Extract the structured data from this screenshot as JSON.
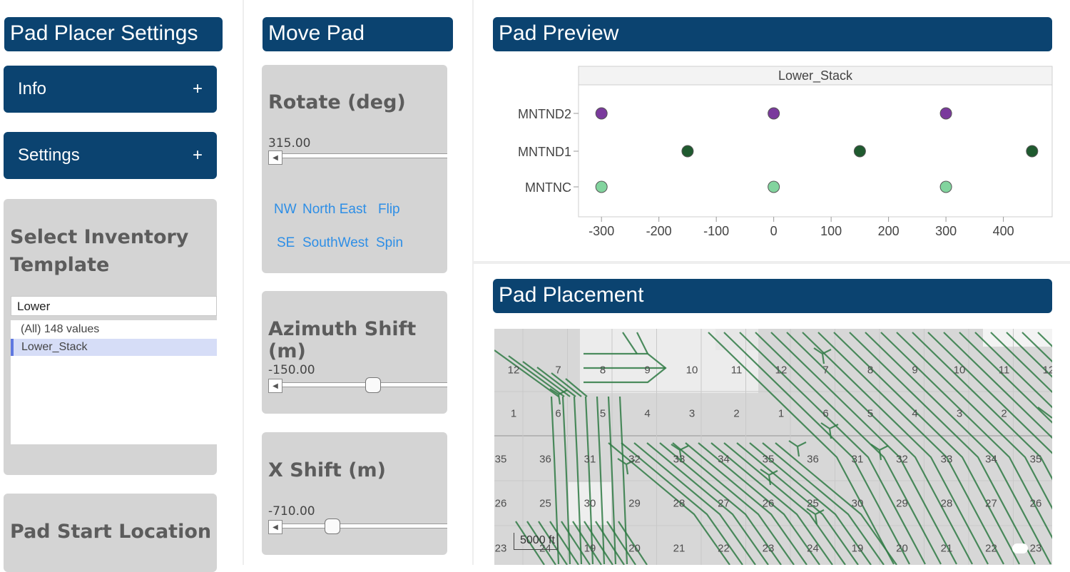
{
  "left": {
    "title": "Pad Placer Settings",
    "info_label": "Info",
    "settings_label": "Settings",
    "expand_glyph": "+",
    "inventory": {
      "title_line1": "Select Inventory",
      "title_line2": "Template",
      "search_value": "Lower",
      "options": [
        "(All) 148 values",
        "Lower_Stack"
      ],
      "selected": "Lower_Stack"
    },
    "pad_start_title": "Pad Start Location"
  },
  "move": {
    "title": "Move Pad",
    "rotate": {
      "title": "Rotate (deg)",
      "value": "315.00",
      "fraction": 0.0
    },
    "directions": [
      "NW",
      "North East",
      "Flip",
      "SE",
      "SouthWest",
      "Spin"
    ],
    "azimuth": {
      "title": "Azimuth Shift (m)",
      "value": "-150.00",
      "fraction": 0.5
    },
    "xshift": {
      "title": "X Shift (m)",
      "value": "-710.00",
      "fraction": 0.25
    }
  },
  "preview": {
    "title": "Pad Preview",
    "chart_data": {
      "type": "scatter",
      "title": "Lower_Stack",
      "categories": [
        "MNTND2",
        "MNTND1",
        "MNTNC"
      ],
      "xticks": [
        -300,
        -200,
        -100,
        0,
        100,
        200,
        300,
        400
      ],
      "xlim": [
        -340,
        485
      ],
      "grid": false,
      "series": [
        {
          "category": "MNTND2",
          "color": "#7a3a9c",
          "x": [
            -300,
            0,
            300
          ]
        },
        {
          "category": "MNTND1",
          "color": "#1f5a2f",
          "x": [
            -150,
            150,
            450
          ]
        },
        {
          "category": "MNTNC",
          "color": "#82d49e",
          "x": [
            -300,
            0,
            300
          ]
        }
      ]
    }
  },
  "placement": {
    "title": "Pad Placement",
    "scale_label": "5000 ft",
    "section_rows": [
      [
        "12",
        "7",
        "8",
        "9",
        "10",
        "11",
        "12",
        "7",
        "8",
        "9",
        "10",
        "11",
        "12"
      ],
      [
        "1",
        "6",
        "5",
        "4",
        "3",
        "2",
        "1",
        "6",
        "5",
        "4",
        "3",
        "2"
      ],
      [
        "35",
        "36",
        "31",
        "32",
        "33",
        "34",
        "35",
        "36",
        "31",
        "32",
        "33",
        "34",
        "35"
      ],
      [
        "26",
        "25",
        "30",
        "29",
        "28",
        "27",
        "26",
        "25",
        "30",
        "29",
        "28",
        "27",
        "26"
      ],
      [
        "23",
        "24",
        "19",
        "20",
        "21",
        "22",
        "23",
        "24",
        "19",
        "20",
        "21",
        "22",
        "23"
      ]
    ],
    "colors": {
      "map_bg": "#d7d7d7",
      "well": "#2f7a44"
    }
  },
  "colors": {
    "header": "#0b4370",
    "card": "#d4d4d4",
    "link": "#2d8ee6"
  }
}
